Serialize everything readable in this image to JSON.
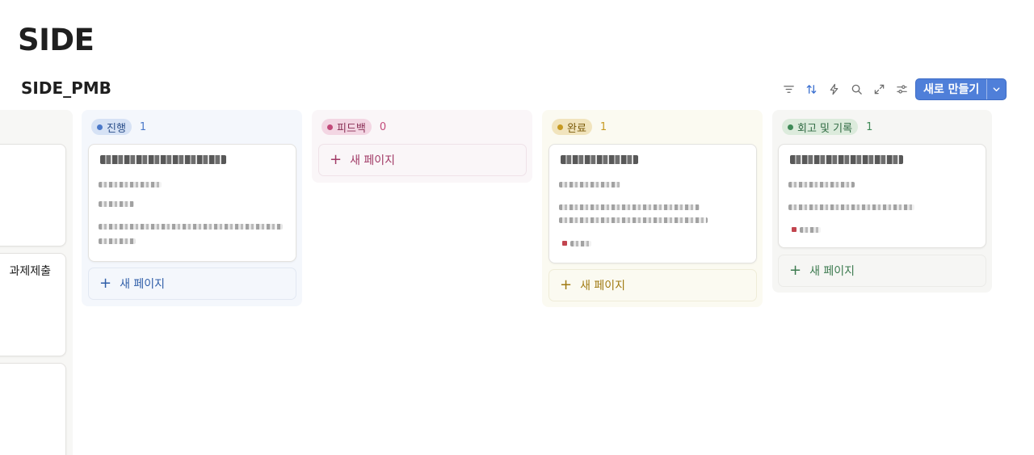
{
  "page": {
    "title": "SIDE"
  },
  "database": {
    "title": "SIDE_PMB"
  },
  "toolbar": {
    "icons": [
      "filter-icon",
      "sort-icon",
      "lightning-icon",
      "search-icon",
      "expand-icon",
      "settings-icon"
    ],
    "new_button_label": "새로 만들기",
    "accent_color": "#4f7fd9"
  },
  "board": {
    "partial_column": {
      "card_text": "과제제출"
    },
    "columns": [
      {
        "label": "진행",
        "count": "1",
        "color": "#4a78c9",
        "bg": "#f4f7fc",
        "tag_bg": "#d6e2f5",
        "text_color": "#2f5ea8",
        "add_label": "새 페이지"
      },
      {
        "label": "피드백",
        "count": "0",
        "color": "#c24a7a",
        "bg": "#faf6f8",
        "tag_bg": "#f3d6e3",
        "text_color": "#a13a66",
        "add_label": "새 페이지"
      },
      {
        "label": "완료",
        "count": "1",
        "color": "#c79a22",
        "bg": "#fbfaf1",
        "tag_bg": "#f1e4bd",
        "text_color": "#a07a12",
        "add_label": "새 페이지"
      },
      {
        "label": "회고 및 기록",
        "count": "1",
        "color": "#3f8a57",
        "bg": "#f6f6f4",
        "tag_bg": "#dcebdc",
        "text_color": "#3c7a4f",
        "add_label": "새 페이지"
      }
    ]
  }
}
